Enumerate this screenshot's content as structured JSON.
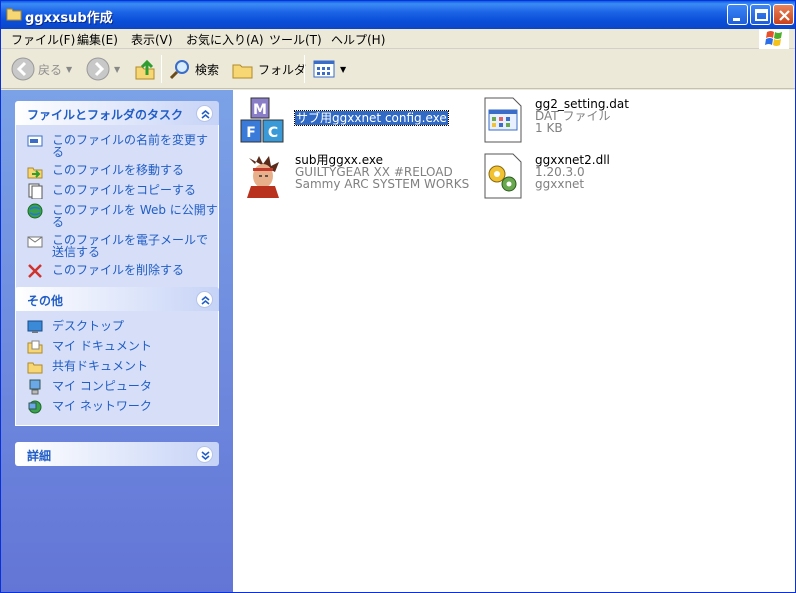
{
  "window": {
    "title": "ggxxsub作成"
  },
  "menu": [
    "ファイル(F)",
    "編集(E)",
    "表示(V)",
    "お気に入り(A)",
    "ツール(T)",
    "ヘルプ(H)"
  ],
  "toolbar": {
    "back": "戻る",
    "search": "検索",
    "folders": "フォルダ"
  },
  "file_tasks": {
    "title": "ファイルとフォルダのタスク",
    "items": [
      {
        "label": "このファイルの名前を変更する",
        "icon": "rename-icon"
      },
      {
        "label": "このファイルを移動する",
        "icon": "move-icon"
      },
      {
        "label": "このファイルをコピーする",
        "icon": "copy-icon"
      },
      {
        "label": "このファイルを Web に公開する",
        "icon": "publish-web-icon"
      },
      {
        "label": "このファイルを電子メールで送信する",
        "icon": "email-icon"
      },
      {
        "label": "このファイルを削除する",
        "icon": "delete-icon"
      }
    ]
  },
  "other_places": {
    "title": "その他",
    "items": [
      {
        "label": "デスクトップ",
        "icon": "desktop-icon"
      },
      {
        "label": "マイ ドキュメント",
        "icon": "my-documents-icon"
      },
      {
        "label": "共有ドキュメント",
        "icon": "shared-documents-icon"
      },
      {
        "label": "マイ コンピュータ",
        "icon": "my-computer-icon"
      },
      {
        "label": "マイ ネットワーク",
        "icon": "my-network-icon"
      }
    ]
  },
  "details": {
    "title": "詳細"
  },
  "files": [
    {
      "name": "サブ用ggxxnet config.exe",
      "line2": "",
      "line3": "",
      "selected": true,
      "icon": "mfc-app-icon"
    },
    {
      "name": "gg2_setting.dat",
      "line2": "DAT ファイル",
      "line3": "1 KB",
      "selected": false,
      "icon": "dat-file-icon"
    },
    {
      "name": "sub用ggxx.exe",
      "line2": "GUILTYGEAR XX #RELOAD",
      "line3": "Sammy ARC SYSTEM WORKS",
      "selected": false,
      "icon": "game-character-icon"
    },
    {
      "name": "ggxxnet2.dll",
      "line2": "1.20.3.0",
      "line3": "ggxxnet",
      "selected": false,
      "icon": "dll-file-icon"
    }
  ]
}
